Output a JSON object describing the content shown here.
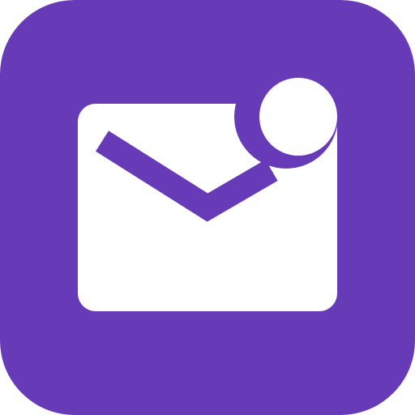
{
  "app_icon": {
    "icon_name": "mail-notification-icon",
    "colors": {
      "background": "#673AB7",
      "foreground": "#FFFFFF"
    }
  }
}
